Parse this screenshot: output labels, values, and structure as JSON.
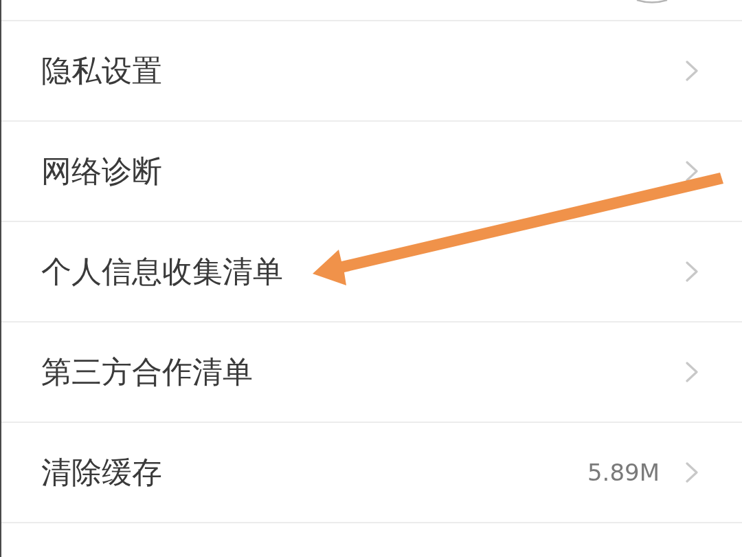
{
  "rows": [
    {
      "label": "隐私设置"
    },
    {
      "label": "网络诊断"
    },
    {
      "label": "个人信息收集清单"
    },
    {
      "label": "第三方合作清单"
    },
    {
      "label": "清除缓存",
      "value": "5.89M"
    }
  ]
}
